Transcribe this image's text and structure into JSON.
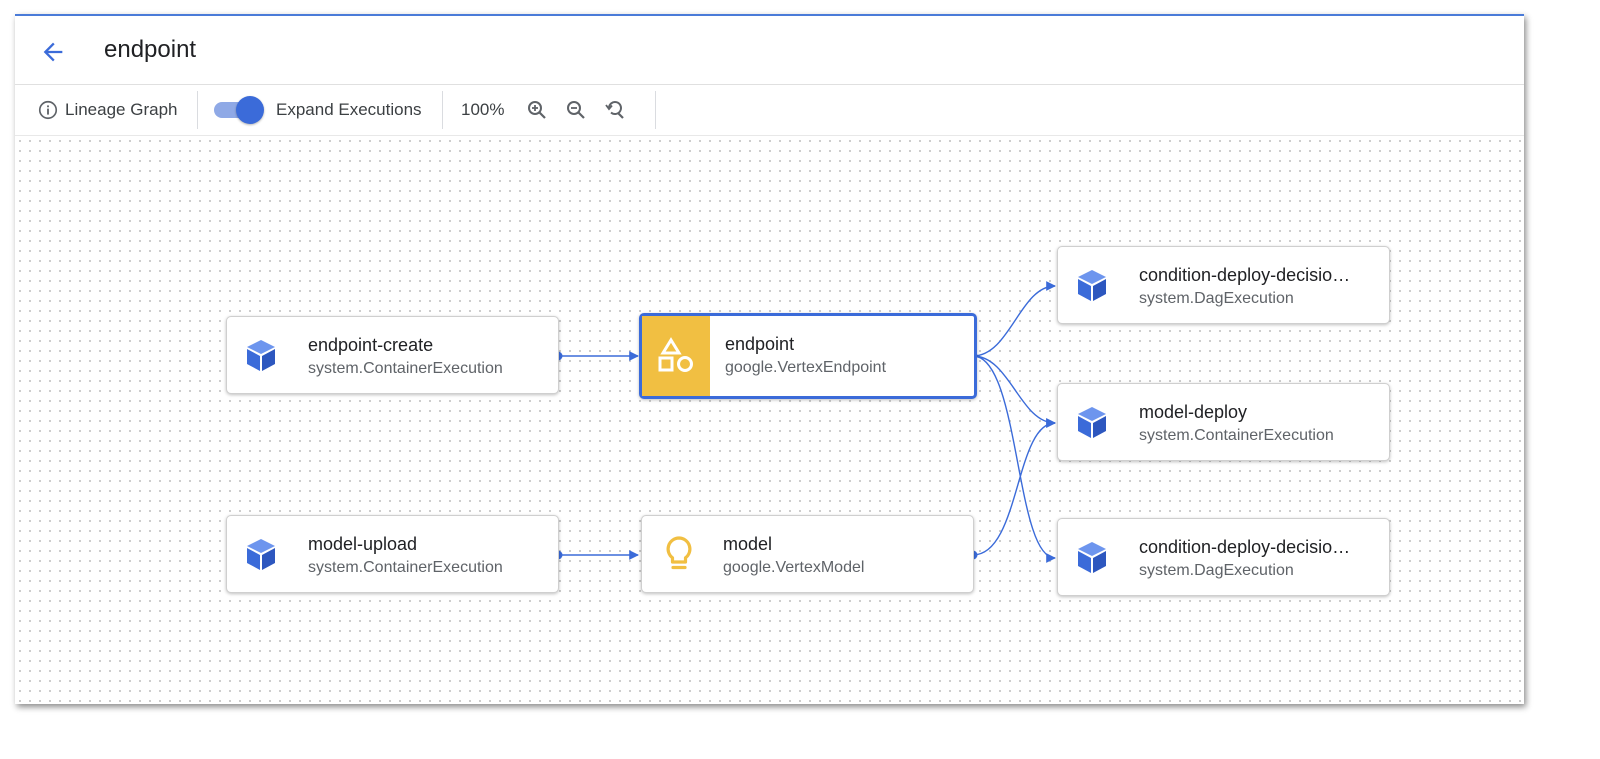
{
  "header": {
    "title": "endpoint"
  },
  "toolbar": {
    "info_label": "Lineage Graph",
    "toggle_label": "Expand Executions",
    "toggle_on": true,
    "zoom_level": "100%"
  },
  "nodes": {
    "endpoint_create": {
      "name": "endpoint-create",
      "type": "system.ContainerExecution",
      "icon": "cube-icon"
    },
    "model_upload": {
      "name": "model-upload",
      "type": "system.ContainerExecution",
      "icon": "cube-icon"
    },
    "endpoint": {
      "name": "endpoint",
      "type": "google.VertexEndpoint",
      "icon": "shapes-icon"
    },
    "model": {
      "name": "model",
      "type": "google.VertexModel",
      "icon": "lightbulb-icon"
    },
    "condition_1": {
      "name": "condition-deploy-decisio…",
      "type": "system.DagExecution",
      "icon": "cube-icon"
    },
    "model_deploy": {
      "name": "model-deploy",
      "type": "system.ContainerExecution",
      "icon": "cube-icon"
    },
    "condition_2": {
      "name": "condition-deploy-decisio…",
      "type": "system.DagExecution",
      "icon": "cube-icon"
    }
  },
  "colors": {
    "accent": "#3b6bd9",
    "edge": "#3b6bd9",
    "artifact_yellow": "#f1bf42"
  }
}
